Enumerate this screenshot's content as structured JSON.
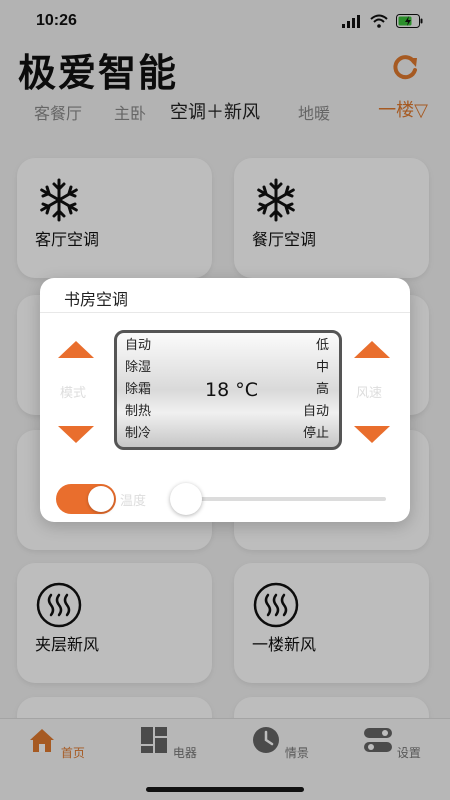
{
  "status": {
    "time": "10:26"
  },
  "app": {
    "title": "极爱智能"
  },
  "tabs": [
    {
      "label": "客餐厅"
    },
    {
      "label": "主卧"
    },
    {
      "label": "空调＋新风"
    },
    {
      "label": "地暖"
    }
  ],
  "floor": {
    "label": "一楼▽"
  },
  "devices": [
    {
      "label": "客厅空调",
      "icon": "snowflake-icon"
    },
    {
      "label": "餐厅空调",
      "icon": "snowflake-icon"
    },
    {
      "label": "夹层新风",
      "icon": "fresh-air-icon"
    },
    {
      "label": "一楼新风",
      "icon": "fresh-air-icon"
    }
  ],
  "dialog": {
    "title": "书房空调",
    "left_label": "模式",
    "right_label": "风速",
    "modes": [
      "自动",
      "除湿",
      "除霜",
      "制热",
      "制冷"
    ],
    "fan_speeds": [
      "低",
      "中",
      "高",
      "自动",
      "停止"
    ],
    "temperature": "18 °C",
    "switch_label": "温度",
    "switch_on": true,
    "slider_level": 0
  },
  "bottom_tabs": [
    {
      "label": "首页",
      "icon": "home-icon"
    },
    {
      "label": "电器",
      "icon": "appliances-icon"
    },
    {
      "label": "情景",
      "icon": "clock-icon"
    },
    {
      "label": "设置",
      "icon": "settings-icon"
    }
  ],
  "colors": {
    "accent": "#e96e2d",
    "floor": "#e07a2f"
  }
}
